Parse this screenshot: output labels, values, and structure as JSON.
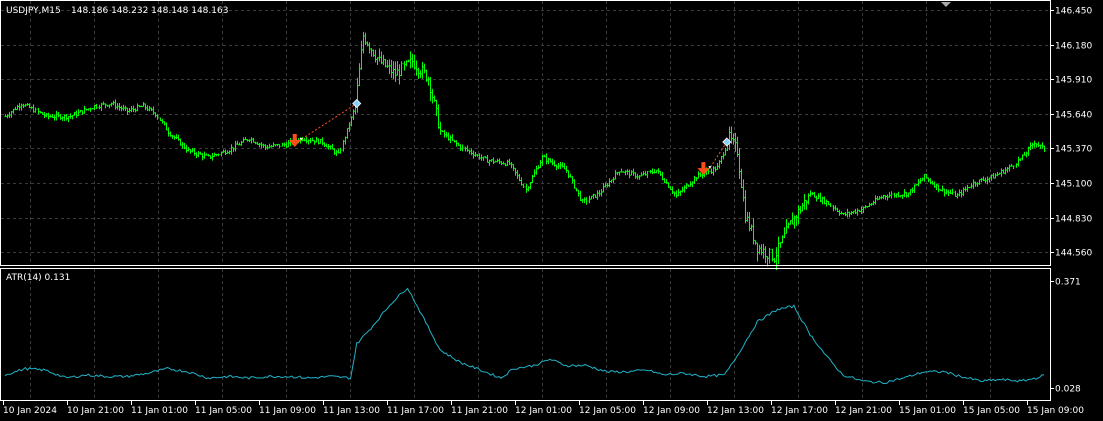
{
  "symbol_info": {
    "label": "USDJPY,M15",
    "ohlc": "148.186 148.232 148.148 148.163"
  },
  "indicator_info": {
    "label": "ATR(14) 0.131"
  },
  "colors": {
    "background": "#000000",
    "grid": "#3a3a3a",
    "candle": "#00ff00",
    "atr_line": "#20b2c8",
    "axis_text": "#ffffff",
    "trade_sell": "#ff4d1a",
    "trade_marker": "#87cefa"
  },
  "icons": {
    "trade_arrow": "trade-arrow-icon",
    "trade_entry": "trade-entry-icon",
    "scroll_marker": "scroll-marker-icon"
  },
  "chart_data": [
    {
      "type": "candlestick",
      "title": "USDJPY,M15",
      "y_ticks": [
        "146.450",
        "146.180",
        "145.910",
        "145.640",
        "145.370",
        "145.100",
        "144.830",
        "144.560"
      ],
      "ylim": [
        144.46,
        146.52
      ],
      "x_ticks": [
        "10 Jan 2024",
        "10 Jan 21:00",
        "11 Jan 01:00",
        "11 Jan 05:00",
        "11 Jan 09:00",
        "11 Jan 13:00",
        "11 Jan 17:00",
        "11 Jan 21:00",
        "12 Jan 01:00",
        "12 Jan 05:00",
        "12 Jan 09:00",
        "12 Jan 13:00",
        "12 Jan 17:00",
        "12 Jan 21:00",
        "15 Jan 01:00",
        "15 Jan 05:00",
        "15 Jan 09:00"
      ],
      "price_path": [
        [
          0,
          145.62
        ],
        [
          8,
          145.72
        ],
        [
          20,
          145.62
        ],
        [
          32,
          145.62
        ],
        [
          44,
          145.7
        ],
        [
          52,
          145.72
        ],
        [
          60,
          145.66
        ],
        [
          68,
          145.7
        ],
        [
          74,
          145.64
        ],
        [
          80,
          145.5
        ],
        [
          90,
          145.35
        ],
        [
          100,
          145.3
        ],
        [
          110,
          145.36
        ],
        [
          120,
          145.45
        ],
        [
          128,
          145.38
        ],
        [
          138,
          145.4
        ],
        [
          146,
          145.45
        ],
        [
          156,
          145.42
        ],
        [
          164,
          145.32
        ],
        [
          172,
          145.7
        ],
        [
          176,
          146.25
        ],
        [
          184,
          146.05
        ],
        [
          192,
          145.95
        ],
        [
          200,
          146.05
        ],
        [
          208,
          145.92
        ],
        [
          214,
          145.5
        ],
        [
          224,
          145.38
        ],
        [
          236,
          145.28
        ],
        [
          248,
          145.25
        ],
        [
          256,
          145.05
        ],
        [
          264,
          145.3
        ],
        [
          276,
          145.2
        ],
        [
          284,
          144.95
        ],
        [
          292,
          145.02
        ],
        [
          302,
          145.2
        ],
        [
          312,
          145.15
        ],
        [
          320,
          145.2
        ],
        [
          330,
          145.0
        ],
        [
          340,
          145.15
        ],
        [
          350,
          145.22
        ],
        [
          356,
          145.45
        ],
        [
          360,
          145.35
        ],
        [
          364,
          144.85
        ],
        [
          370,
          144.6
        ],
        [
          378,
          144.52
        ],
        [
          386,
          144.78
        ],
        [
          396,
          145.02
        ],
        [
          404,
          144.95
        ],
        [
          412,
          144.85
        ],
        [
          422,
          144.9
        ],
        [
          432,
          145.0
        ],
        [
          444,
          145.02
        ],
        [
          452,
          145.15
        ],
        [
          460,
          145.05
        ],
        [
          468,
          145.0
        ],
        [
          476,
          145.1
        ],
        [
          486,
          145.15
        ],
        [
          494,
          145.22
        ],
        [
          500,
          145.3
        ],
        [
          506,
          145.42
        ],
        [
          512,
          145.35
        ]
      ],
      "trades": [
        {
          "type": "sell",
          "price": 145.42,
          "bar": 143
        },
        {
          "type": "close",
          "price": 145.72,
          "bar": 173
        },
        {
          "type": "sell",
          "price": 145.2,
          "bar": 344
        },
        {
          "type": "close",
          "price": 145.42,
          "bar": 355
        }
      ]
    },
    {
      "type": "line",
      "title": "ATR(14) 0.131",
      "y_ticks": [
        "0.371",
        "0.028"
      ],
      "ylim": [
        0.028,
        0.371
      ],
      "series": [
        {
          "values": [
            [
              0,
              0.07
            ],
            [
              10,
              0.09
            ],
            [
              20,
              0.085
            ],
            [
              30,
              0.06
            ],
            [
              40,
              0.07
            ],
            [
              50,
              0.065
            ],
            [
              60,
              0.065
            ],
            [
              70,
              0.075
            ],
            [
              80,
              0.09
            ],
            [
              90,
              0.08
            ],
            [
              100,
              0.06
            ],
            [
              110,
              0.065
            ],
            [
              120,
              0.06
            ],
            [
              130,
              0.065
            ],
            [
              140,
              0.065
            ],
            [
              150,
              0.06
            ],
            [
              160,
              0.065
            ],
            [
              170,
              0.06
            ],
            [
              173,
              0.17
            ],
            [
              180,
              0.22
            ],
            [
              190,
              0.3
            ],
            [
              198,
              0.35
            ],
            [
              206,
              0.25
            ],
            [
              214,
              0.15
            ],
            [
              224,
              0.11
            ],
            [
              236,
              0.08
            ],
            [
              244,
              0.06
            ],
            [
              250,
              0.09
            ],
            [
              260,
              0.1
            ],
            [
              268,
              0.12
            ],
            [
              276,
              0.1
            ],
            [
              286,
              0.1
            ],
            [
              296,
              0.08
            ],
            [
              306,
              0.08
            ],
            [
              316,
              0.085
            ],
            [
              324,
              0.07
            ],
            [
              334,
              0.075
            ],
            [
              344,
              0.065
            ],
            [
              354,
              0.07
            ],
            [
              360,
              0.13
            ],
            [
              370,
              0.24
            ],
            [
              380,
              0.28
            ],
            [
              388,
              0.29
            ],
            [
              396,
              0.2
            ],
            [
              404,
              0.13
            ],
            [
              412,
              0.07
            ],
            [
              422,
              0.05
            ],
            [
              432,
              0.045
            ],
            [
              442,
              0.06
            ],
            [
              452,
              0.08
            ],
            [
              462,
              0.08
            ],
            [
              470,
              0.065
            ],
            [
              480,
              0.05
            ],
            [
              490,
              0.055
            ],
            [
              500,
              0.05
            ],
            [
              507,
              0.06
            ],
            [
              512,
              0.07
            ]
          ]
        }
      ]
    }
  ]
}
